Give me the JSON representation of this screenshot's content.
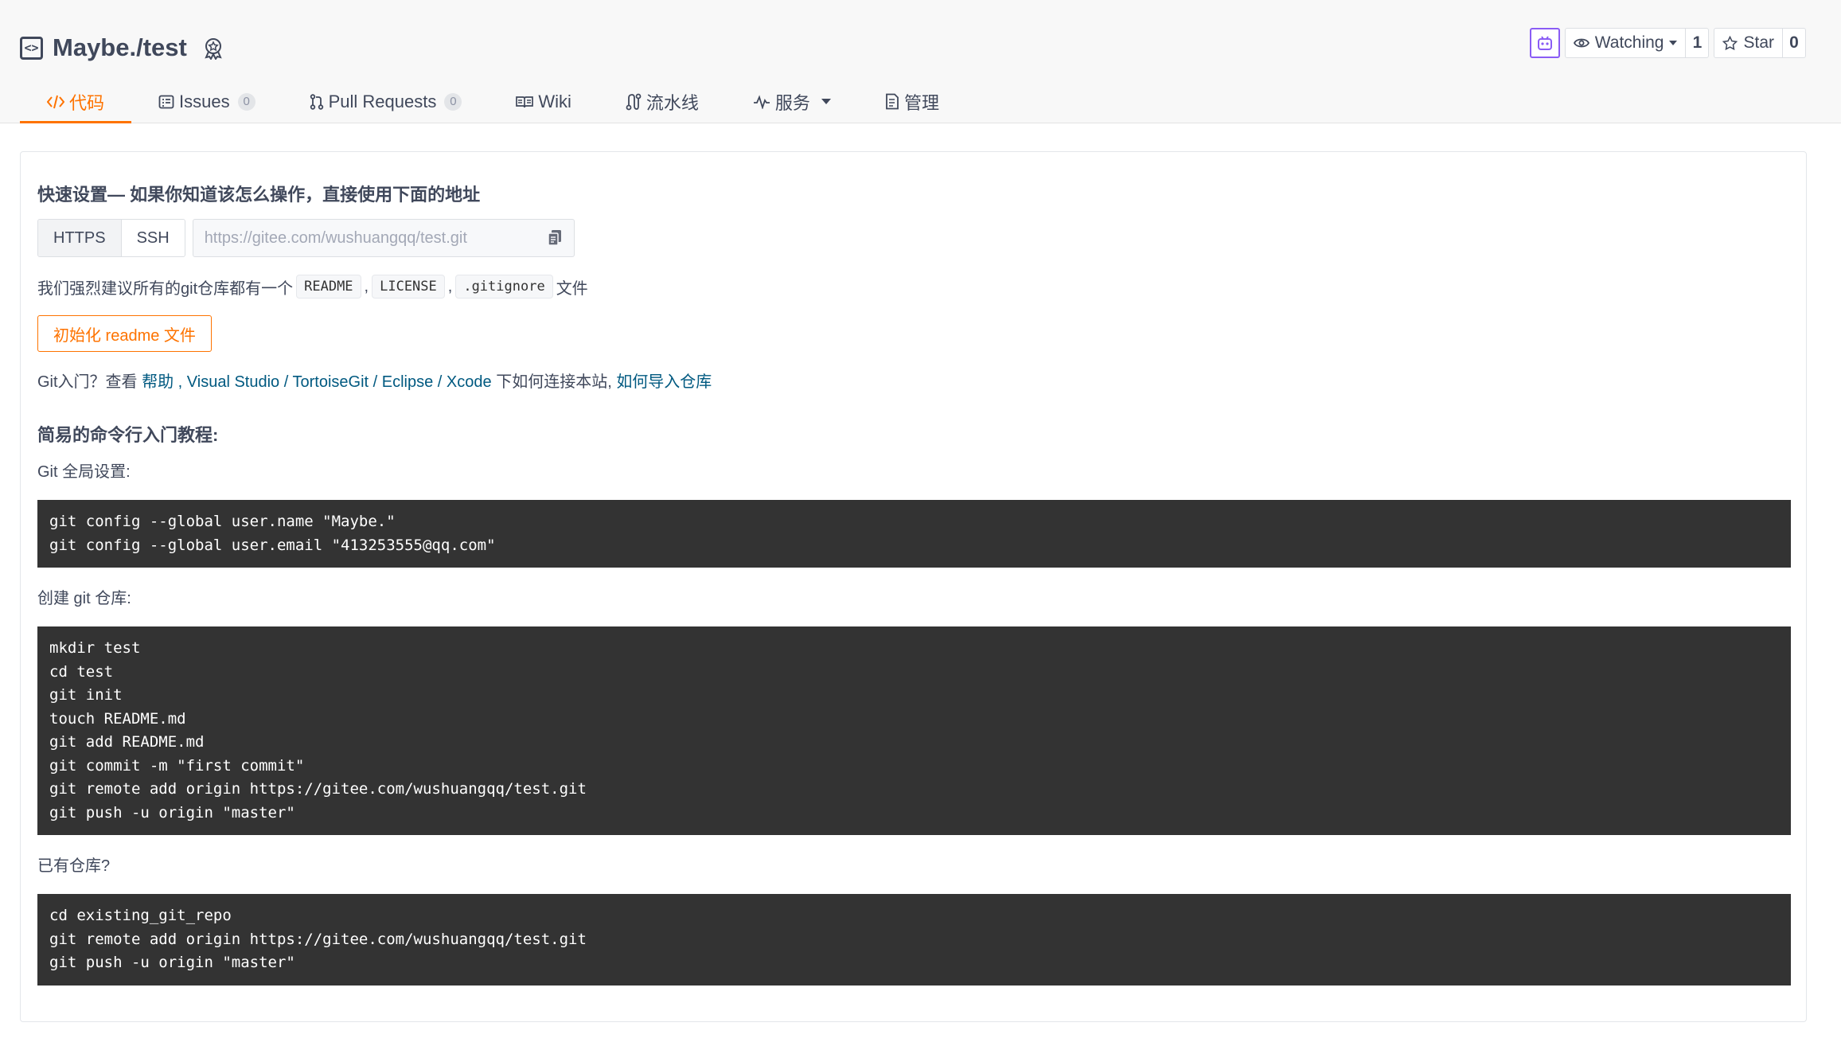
{
  "repo": {
    "name": "Maybe./test"
  },
  "actions": {
    "watch_label": "Watching",
    "watch_count": "1",
    "star_label": "Star",
    "star_count": "0"
  },
  "tabs": [
    {
      "label": "代码",
      "count": null,
      "icon": "code-icon",
      "active": true
    },
    {
      "label": "Issues",
      "count": "0",
      "icon": "issues-icon",
      "active": false
    },
    {
      "label": "Pull Requests",
      "count": "0",
      "icon": "pull-request-icon",
      "active": false
    },
    {
      "label": "Wiki",
      "count": null,
      "icon": "wiki-book-icon",
      "active": false
    },
    {
      "label": "流水线",
      "count": null,
      "icon": "pipeline-icon",
      "active": false
    },
    {
      "label": "服务",
      "count": null,
      "icon": "pulse-icon",
      "active": false
    },
    {
      "label": "管理",
      "count": null,
      "icon": "manage-icon",
      "active": false
    }
  ],
  "quick_setup": {
    "title": "快速设置— 如果你知道该怎么操作，直接使用下面的地址",
    "protocols": [
      "HTTPS",
      "SSH"
    ],
    "active_protocol": "HTTPS",
    "url": "https://gitee.com/wushuangqq/test.git",
    "recommend_prefix": "我们强烈建议所有的git仓库都有一个",
    "recommend_files": [
      "README",
      "LICENSE",
      ".gitignore"
    ],
    "recommend_suffix": "文件",
    "init_button": "初始化 readme 文件",
    "intro_prefix": "Git入门？查看 ",
    "intro_help": "帮助",
    "intro_tools": [
      "Visual Studio",
      "TortoiseGit",
      "Eclipse",
      "Xcode"
    ],
    "intro_middle": " 下如何连接本站, ",
    "intro_import": "如何导入仓库"
  },
  "tutorial": {
    "title": "简易的命令行入门教程:",
    "sections": [
      {
        "label": "Git 全局设置:",
        "lines": [
          "git config --global user.name \"Maybe.\"",
          "git config --global user.email \"413253555@qq.com\""
        ]
      },
      {
        "label": "创建 git 仓库:",
        "lines": [
          "mkdir test",
          "cd test",
          "git init",
          "touch README.md",
          "git add README.md",
          "git commit -m \"first commit\"",
          "git remote add origin https://gitee.com/wushuangqq/test.git",
          "git push -u origin \"master\""
        ]
      },
      {
        "label": "已有仓库?",
        "lines": [
          "cd existing_git_repo",
          "git remote add origin https://gitee.com/wushuangqq/test.git",
          "git push -u origin \"master\""
        ]
      }
    ]
  },
  "colors": {
    "accent": "#fe7300",
    "link": "#005980",
    "code_bg": "#333333",
    "text": "#40485b"
  }
}
